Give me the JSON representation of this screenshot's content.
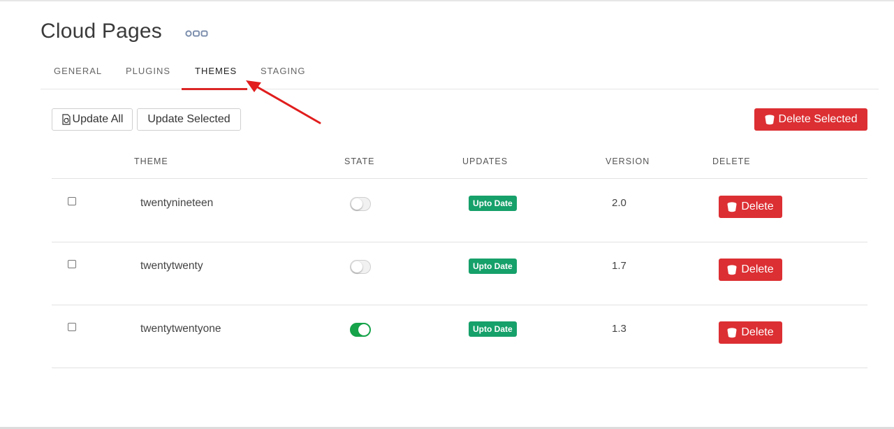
{
  "page": {
    "title": "Cloud Pages"
  },
  "tabs": [
    {
      "label": "GENERAL",
      "active": false
    },
    {
      "label": "PLUGINS",
      "active": false
    },
    {
      "label": "THEMES",
      "active": true
    },
    {
      "label": "STAGING",
      "active": false
    }
  ],
  "toolbar": {
    "update_all_label": "Update All",
    "update_selected_label": "Update Selected",
    "delete_selected_label": "Delete Selected"
  },
  "table": {
    "columns": [
      "THEME",
      "STATE",
      "UPDATES",
      "VERSION",
      "DELETE"
    ],
    "rows": [
      {
        "theme": "twentynineteen",
        "active": false,
        "update_status": "Upto Date",
        "version": "2.0",
        "delete_label": "Delete"
      },
      {
        "theme": "twentytwenty",
        "active": false,
        "update_status": "Upto Date",
        "version": "1.7",
        "delete_label": "Delete"
      },
      {
        "theme": "twentytwentyone",
        "active": true,
        "update_status": "Upto Date",
        "version": "1.3",
        "delete_label": "Delete"
      }
    ]
  },
  "colors": {
    "accent": "#dc2626",
    "danger": "#dc2f33",
    "success": "#16a06a",
    "toggle_on": "#16a34a"
  },
  "icons": {
    "title": "three-gears-icon",
    "update_all": "refresh-document-icon",
    "delete": "bucket-icon"
  }
}
